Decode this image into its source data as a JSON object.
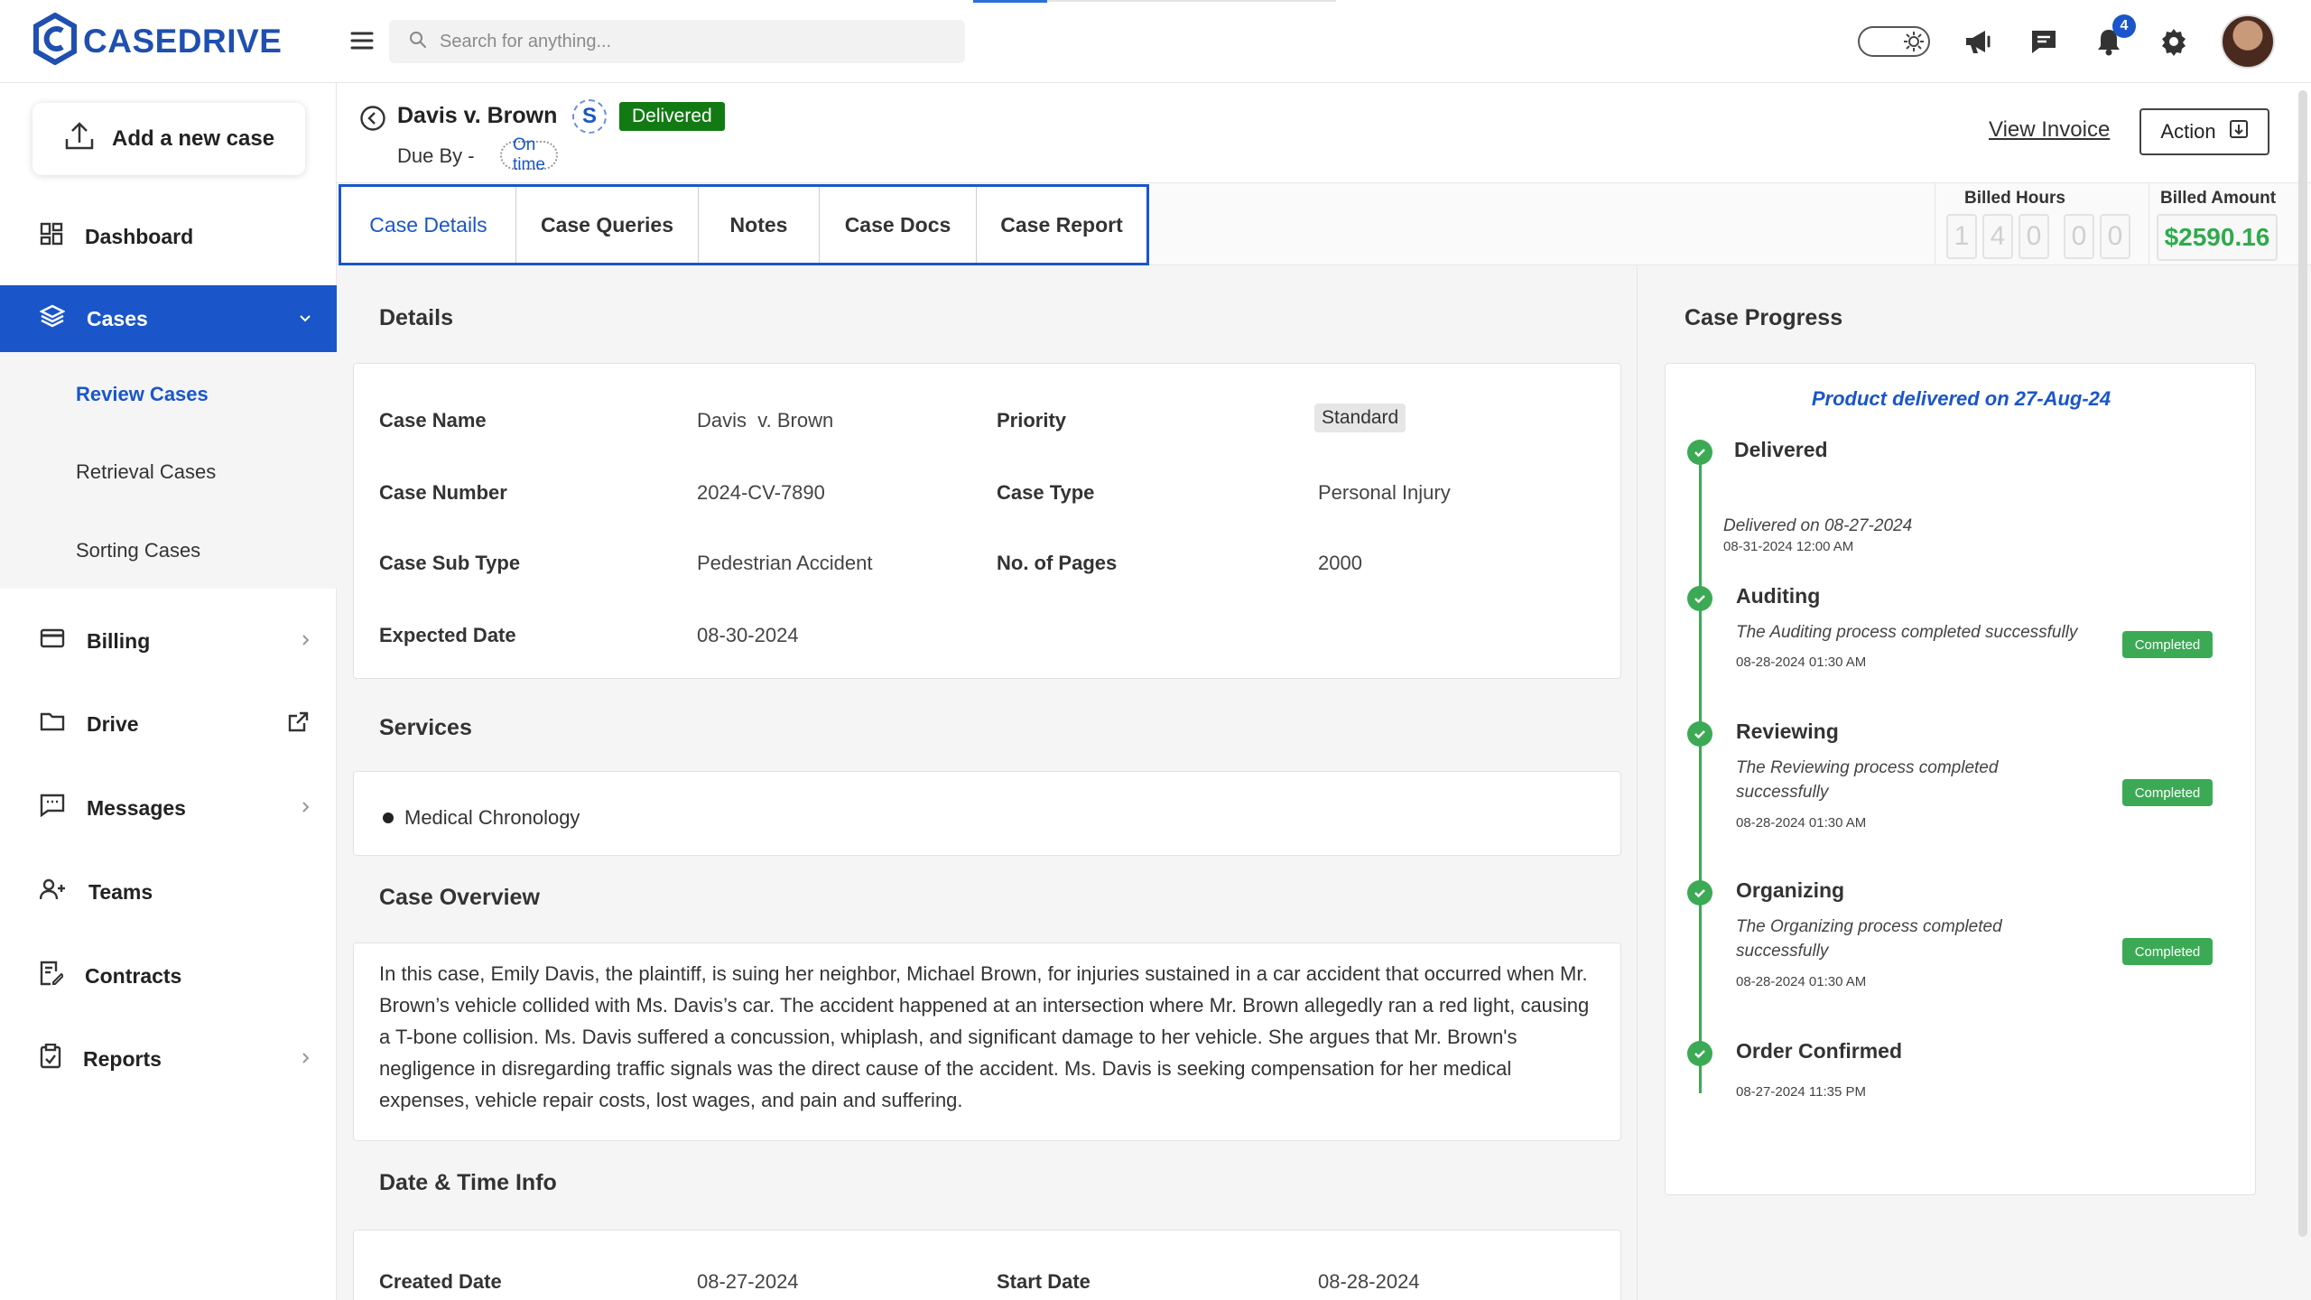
{
  "app": {
    "logo_text": "CASEDRIVE"
  },
  "header": {
    "search_placeholder": "Search for anything...",
    "notification_count": "4"
  },
  "sidebar": {
    "add_case_label": "Add a new case",
    "items": [
      {
        "label": "Dashboard"
      },
      {
        "label": "Cases"
      },
      {
        "label": "Billing"
      },
      {
        "label": "Drive"
      },
      {
        "label": "Messages"
      },
      {
        "label": "Teams"
      },
      {
        "label": "Contracts"
      },
      {
        "label": "Reports"
      }
    ],
    "cases_submenu": [
      "Review Cases",
      "Retrieval Cases",
      "Sorting Cases"
    ]
  },
  "case": {
    "title": "Davis v. Brown",
    "service_letter": "S",
    "status": "Delivered",
    "due_label": "Due By -",
    "due_status": "On time",
    "view_invoice": "View Invoice",
    "action_label": "Action"
  },
  "tabs": [
    "Case Details",
    "Case Queries",
    "Notes",
    "Case Docs",
    "Case Report"
  ],
  "billing": {
    "hours_label": "Billed Hours",
    "hours_digits": [
      "1",
      "4",
      "0",
      "0",
      "0"
    ],
    "amount_label": "Billed Amount",
    "amount": "$2590.16"
  },
  "details": {
    "title": "Details",
    "case_name_label": "Case Name",
    "case_name": "Davis  v. Brown",
    "priority_label": "Priority",
    "priority": "Standard",
    "case_number_label": "Case Number",
    "case_number": "2024-CV-7890",
    "case_type_label": "Case Type",
    "case_type": "Personal Injury",
    "case_sub_type_label": "Case Sub Type",
    "case_sub_type": "Pedestrian Accident",
    "pages_label": "No. of Pages",
    "pages": "2000",
    "expected_date_label": "Expected Date",
    "expected_date": "08-30-2024"
  },
  "services": {
    "title": "Services",
    "items": [
      "Medical Chronology"
    ]
  },
  "overview": {
    "title": "Case Overview",
    "text": "In this case, Emily Davis, the plaintiff, is suing her neighbor, Michael Brown, for injuries sustained in a car accident that occurred when Mr. Brown’s vehicle collided with Ms. Davis’s car. The accident happened at an intersection where Mr. Brown allegedly ran a red light, causing a T-bone collision. Ms. Davis suffered a concussion, whiplash, and significant damage to her vehicle. She argues that Mr. Brown's negligence in disregarding traffic signals was the direct cause of the accident. Ms. Davis is seeking compensation for her medical expenses, vehicle repair costs, lost wages, and pain and suffering."
  },
  "datetime": {
    "title": "Date & Time Info",
    "created_label": "Created Date",
    "created": "08-27-2024",
    "start_label": "Start Date",
    "start": "08-28-2024"
  },
  "progress": {
    "title": "Case Progress",
    "delivered_note": "Product delivered on 27-Aug-24",
    "steps": [
      {
        "name": "Delivered",
        "desc": "Delivered on 08-27-2024",
        "time": "08-31-2024 12:00 AM"
      },
      {
        "name": "Auditing",
        "desc": "The Auditing process completed successfully",
        "time": "08-28-2024 01:30 AM",
        "badge": "Completed"
      },
      {
        "name": "Reviewing",
        "desc": "The Reviewing process completed successfully",
        "time": "08-28-2024 01:30 AM",
        "badge": "Completed"
      },
      {
        "name": "Organizing",
        "desc": "The Organizing process completed successfully",
        "time": "08-28-2024 01:30 AM",
        "badge": "Completed"
      },
      {
        "name": "Order Confirmed",
        "time": "08-27-2024 11:35 PM"
      }
    ]
  },
  "colors": {
    "brand": "#1a56c9",
    "success": "#3caa55",
    "delivered_badge": "#127a12"
  },
  "icons": [
    "casedrive-logo-icon",
    "hamburger-icon",
    "search-icon",
    "theme-toggle",
    "megaphone-icon",
    "chat-icon",
    "bell-icon",
    "gear-icon",
    "upload-icon",
    "grid-icon",
    "layers-icon",
    "card-icon",
    "folder-icon",
    "external-link-icon",
    "message-icon",
    "users-icon",
    "contract-icon",
    "clipboard-icon",
    "chevron-right-icon",
    "chevron-down-icon",
    "back-arrow-icon",
    "invoice-icon",
    "check-circle-icon"
  ]
}
